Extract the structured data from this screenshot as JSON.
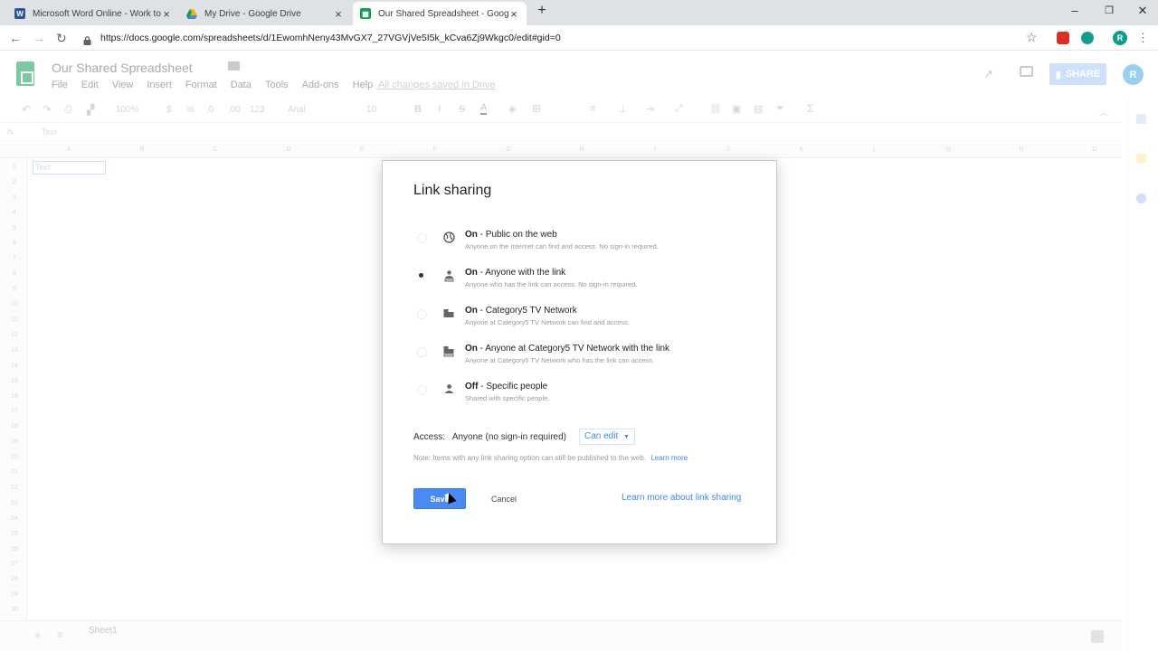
{
  "browser": {
    "tabs": [
      {
        "title": "Microsoft Word Online - Work to",
        "icon": "word-icon",
        "icon_color": "#2b579a"
      },
      {
        "title": "My Drive - Google Drive",
        "icon": "drive-icon",
        "icon_color": "#f4b400"
      },
      {
        "title": "Our Shared Spreadsheet - Goog",
        "icon": "sheets-icon",
        "icon_color": "#0f9d58"
      }
    ],
    "new_tab": "+",
    "url": "https://docs.google.com/spreadsheets/d/1EwomhNeny43MvGX7_27VGVjVe5I5k_kCva6Zj9Wkgc0/edit#gid=0",
    "profile_initial": "R"
  },
  "sheet": {
    "title": "Our Shared Spreadsheet",
    "menus": [
      "File",
      "Edit",
      "View",
      "Insert",
      "Format",
      "Data",
      "Tools",
      "Add-ons",
      "Help"
    ],
    "saved_status": "All changes saved in Drive",
    "share_label": "SHARE",
    "user_initial": "R",
    "toolbar": {
      "zoom": "100%",
      "currency": "$",
      "percent": "%",
      "dec_less": ".0",
      "dec_more": ".00",
      "format": "123",
      "font": "Arial",
      "font_size": "10"
    },
    "fx_value": "Text",
    "columns": [
      "A",
      "B",
      "C",
      "D",
      "E",
      "F",
      "G",
      "H",
      "I",
      "J",
      "K",
      "L",
      "M",
      "N",
      "O"
    ],
    "rows": [
      "1",
      "2",
      "3",
      "4",
      "5",
      "6",
      "7",
      "8",
      "9",
      "10",
      "11",
      "12",
      "13",
      "14",
      "15",
      "16",
      "17",
      "18",
      "19",
      "20",
      "21",
      "22",
      "23",
      "24",
      "25",
      "26",
      "27",
      "28",
      "29",
      "30"
    ],
    "cell_a1": "Text",
    "sheet_tab": "Sheet1"
  },
  "dialog": {
    "title": "Link sharing",
    "options": [
      {
        "main_bold": "On",
        "main_rest": " - Public on the web",
        "sub": "Anyone on the Internet can find and access. No sign-in required.",
        "icon": "globe-icon",
        "selected": false
      },
      {
        "main_bold": "On",
        "main_rest": " - Anyone with the link",
        "sub": "Anyone who has the link can access. No sign-in required.",
        "icon": "person-link-icon",
        "selected": true
      },
      {
        "main_bold": "On",
        "main_rest": " - Category5 TV Network",
        "sub": "Anyone at Category5 TV Network can find and access.",
        "icon": "building-icon",
        "selected": false
      },
      {
        "main_bold": "On",
        "main_rest": " - Anyone at Category5 TV Network with the link",
        "sub": "Anyone at Category5 TV Network who has the link can access.",
        "icon": "building-link-icon",
        "selected": false
      },
      {
        "main_bold": "Off",
        "main_rest": " - Specific people",
        "sub": "Shared with specific people.",
        "icon": "person-icon",
        "selected": false
      }
    ],
    "access_label": "Access:",
    "access_value": "Anyone (no sign-in required)",
    "access_level": "Can edit",
    "note": "Note: Items with any link sharing option can still be published to the web.",
    "note_link": "Learn more",
    "save_label": "Save",
    "cancel_label": "Cancel",
    "learn_link": "Learn more about link sharing"
  }
}
